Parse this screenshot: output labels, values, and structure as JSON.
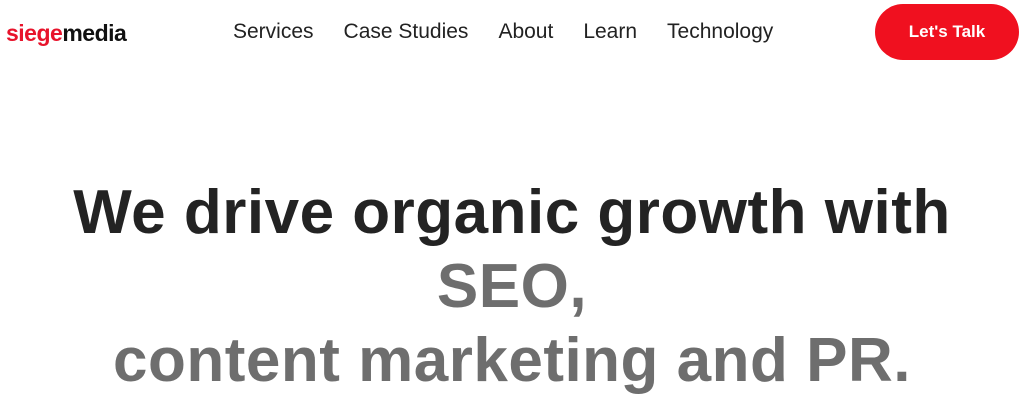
{
  "header": {
    "logo": {
      "part_a": "siege",
      "part_b": "media"
    },
    "nav": [
      {
        "label": "Services"
      },
      {
        "label": "Case Studies"
      },
      {
        "label": "About"
      },
      {
        "label": "Learn"
      },
      {
        "label": "Technology"
      }
    ],
    "cta_label": "Let's Talk"
  },
  "hero": {
    "line1_dark": "We drive organic growth with ",
    "line1_grey": "SEO,",
    "line2_grey": "content marketing and PR."
  },
  "colors": {
    "brand_red": "#f0101f",
    "heading_dark": "#232323",
    "heading_grey": "#6e6e6e"
  }
}
